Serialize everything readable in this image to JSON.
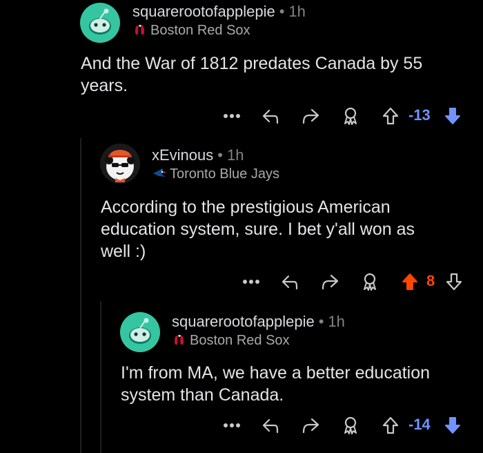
{
  "comments": [
    {
      "username": "squarerootofapplepie",
      "separator": "•",
      "time": "1h",
      "flair": "Boston Red Sox",
      "flair_icon": "red-sox-logo-icon",
      "body_line1": "And the War of 1812 predates Canada by 55",
      "body_line2": "years.",
      "score": "-13",
      "vote_state": "downvoted",
      "score_color": "#7193ff"
    },
    {
      "username": "xEvinous",
      "separator": "•",
      "time": "1h",
      "flair": "Toronto Blue Jays",
      "flair_icon": "blue-jays-logo-icon",
      "body_line1": "According to the prestigious American",
      "body_line2": "education system, sure. I bet y'all won as",
      "body_line3": "well :)",
      "score": "8",
      "vote_state": "upvoted",
      "score_color": "#ff4500"
    },
    {
      "username": "squarerootofapplepie",
      "separator": "•",
      "time": "1h",
      "flair": "Boston Red Sox",
      "flair_icon": "red-sox-logo-icon",
      "body_line1": "I'm from MA, we have a better education",
      "body_line2": "system than Canada.",
      "score": "-14",
      "vote_state": "downvoted",
      "score_color": "#7193ff"
    }
  ],
  "actions": {
    "more": "more-options-icon",
    "reply": "reply-icon",
    "share": "share-icon",
    "award": "award-icon",
    "upvote": "upvote-arrow-icon",
    "downvote": "downvote-arrow-icon"
  },
  "colors": {
    "background": "#000000",
    "upvote": "#ff4500",
    "downvote": "#7193ff",
    "snoo_avatar": "#35c6a1"
  }
}
